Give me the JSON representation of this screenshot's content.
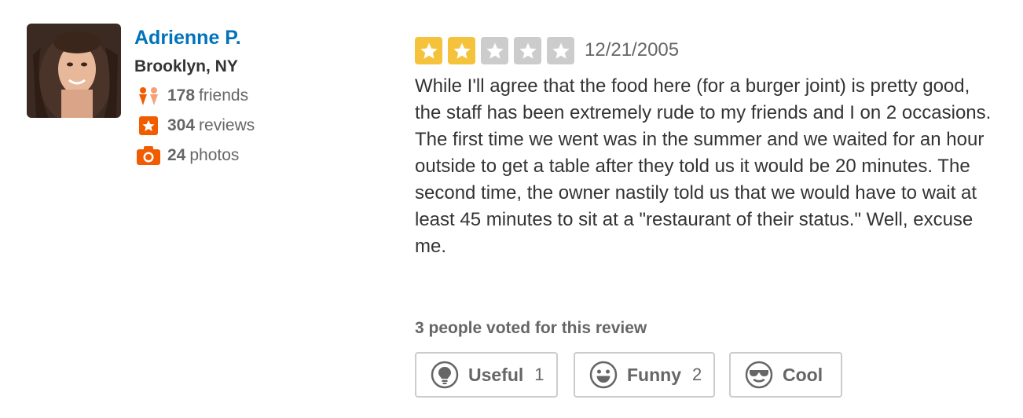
{
  "user": {
    "name": "Adrienne P.",
    "location": "Brooklyn, NY",
    "stats": {
      "friends_count": "178",
      "friends_label": "friends",
      "reviews_count": "304",
      "reviews_label": "reviews",
      "photos_count": "24",
      "photos_label": "photos"
    }
  },
  "review": {
    "rating": 2,
    "max_rating": 5,
    "date": "12/21/2005",
    "text": "While I'll agree that the food here (for a burger joint) is pretty good, the staff has been extremely rude to my friends and I on 2 occasions. The first time we went was in the summer and we waited for an hour outside to get a table after they told us it would be 20 minutes. The second time, the owner nastily told us that we would have to wait at least 45 minutes to sit at a \"restaurant of their status.\" Well, excuse me."
  },
  "votes": {
    "summary": "3 people voted for this review",
    "buttons": [
      {
        "label": "Useful",
        "count": "1",
        "icon": "lightbulb-icon"
      },
      {
        "label": "Funny",
        "count": "2",
        "icon": "smiley-icon"
      },
      {
        "label": "Cool",
        "count": "",
        "icon": "sunglasses-icon"
      }
    ]
  },
  "colors": {
    "name_link": "#0073bb",
    "star_filled": "#f5c33b",
    "star_empty": "#cccccc",
    "stat_icon": "#f15c00"
  }
}
